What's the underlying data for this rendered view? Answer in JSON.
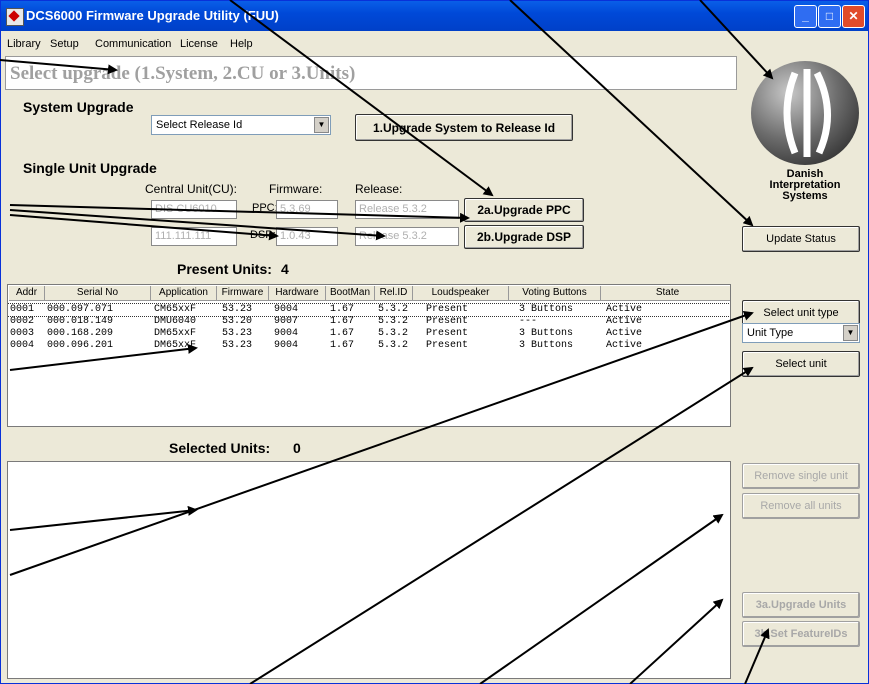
{
  "window": {
    "title": "DCS6000 Firmware Upgrade Utility (FUU)"
  },
  "menu": [
    "Library",
    "Setup",
    "Communication",
    "License",
    "Help"
  ],
  "banner": "Select upgrade (1.System, 2.CU or 3.Units)",
  "system": {
    "heading": "System Upgrade",
    "release_select": "Select Release Id",
    "upgrade_button": "1.Upgrade System to Release Id"
  },
  "single": {
    "heading": "Single Unit Upgrade",
    "cu_label": "Central Unit(CU):",
    "firmware_label": "Firmware:",
    "release_label": "Release:",
    "cu_name": "DIS CU6010",
    "cu_ip": "111.111.111",
    "ppc_label": "PPC:",
    "ppc_fw": "5.3.69",
    "dsp_label": "DSP:",
    "dsp_fw": "1.0.43",
    "ppc_release": "Release 5.3.2",
    "dsp_release": "Release 5.3.2",
    "upgrade_ppc": "2a.Upgrade PPC",
    "upgrade_dsp": "2b.Upgrade DSP"
  },
  "logo": {
    "line1": "Danish",
    "line2": "Interpretation",
    "line3": "Systems"
  },
  "update_status": "Update Status",
  "present": {
    "label": "Present Units:",
    "count": "4",
    "columns": [
      "Addr",
      "Serial No",
      "Application",
      "Firmware",
      "Hardware",
      "BootMan",
      "Rel.ID",
      "Loudspeaker",
      "Voting Buttons",
      "State"
    ],
    "rows": [
      [
        "0001",
        "000.097.071",
        "CM65xxF",
        "53.23",
        "9004",
        "1.67",
        "5.3.2",
        "Present",
        "3 Buttons",
        "Active"
      ],
      [
        "0002",
        "000.018.149",
        "DMU6040",
        "53.20",
        "9007",
        "1.67",
        "5.3.2",
        "Present",
        "---",
        "Active"
      ],
      [
        "0003",
        "000.168.209",
        "DM65xxF",
        "53.23",
        "9004",
        "1.67",
        "5.3.2",
        "Present",
        "3 Buttons",
        "Active"
      ],
      [
        "0004",
        "000.096.201",
        "DM65xxF",
        "53.23",
        "9004",
        "1.67",
        "5.3.2",
        "Present",
        "3 Buttons",
        "Active"
      ]
    ]
  },
  "select_unit_type": "Select unit type",
  "unit_type_value": "Unit Type",
  "select_unit": "Select unit",
  "selected": {
    "label": "Selected Units:",
    "count": "0"
  },
  "remove_single": "Remove single unit",
  "remove_all": "Remove all units",
  "upgrade_units": "3a.Upgrade Units",
  "set_feature": "3b.Set FeatureIDs"
}
